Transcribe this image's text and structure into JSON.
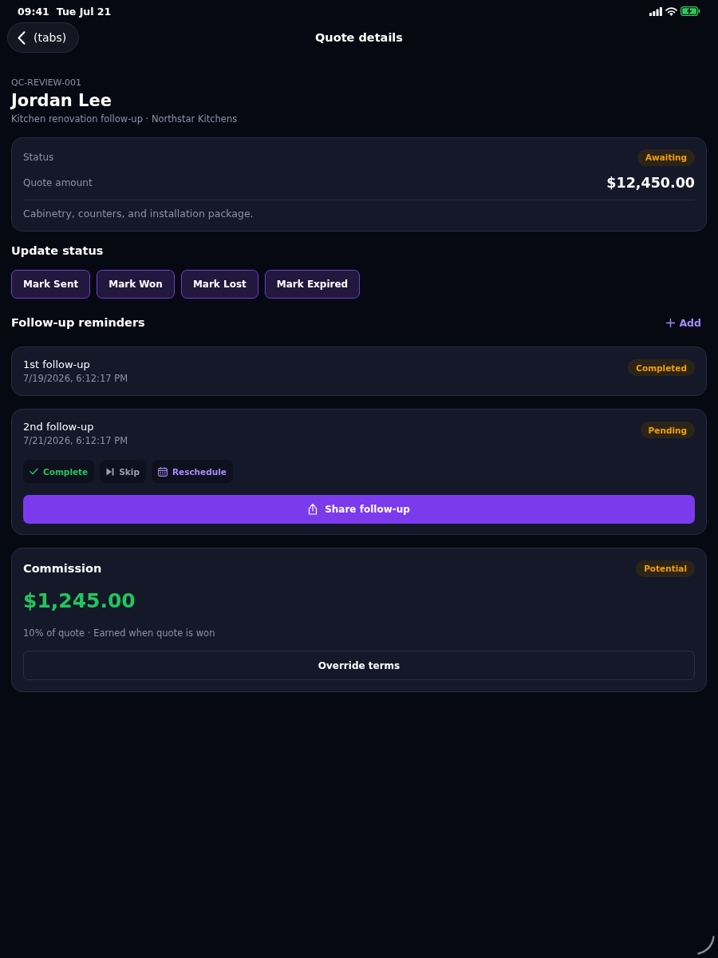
{
  "status_bar": {
    "time": "09:41",
    "date": "Tue Jul 21"
  },
  "nav": {
    "back_label": "(tabs)",
    "title": "Quote details"
  },
  "header": {
    "code": "QC-REVIEW-001",
    "name": "Jordan Lee",
    "subtitle": "Kitchen renovation follow-up · Northstar Kitchens"
  },
  "summary": {
    "status_label": "Status",
    "status": "Awaiting",
    "amount_label": "Quote amount",
    "amount": "$12,450.00",
    "description": "Cabinetry, counters, and installation package."
  },
  "update_status": {
    "title": "Update status",
    "buttons": [
      "Mark Sent",
      "Mark Won",
      "Mark Lost",
      "Mark Expired"
    ]
  },
  "reminders": {
    "title": "Follow-up reminders",
    "add_label": "Add",
    "items": [
      {
        "title": "1st follow-up",
        "date": "7/19/2026, 6:12:17 PM",
        "status": "Completed"
      },
      {
        "title": "2nd follow-up",
        "date": "7/21/2026, 6:12:17 PM",
        "status": "Pending",
        "actions": [
          {
            "kind": "complete",
            "label": "Complete"
          },
          {
            "kind": "skip",
            "label": "Skip"
          },
          {
            "kind": "reschedule",
            "label": "Reschedule"
          }
        ],
        "share_label": "Share follow-up"
      }
    ]
  },
  "commission": {
    "title": "Commission",
    "status": "Potential",
    "amount": "$1,245.00",
    "note": "10% of quote · Earned when quote is won",
    "button": "Override terms"
  }
}
